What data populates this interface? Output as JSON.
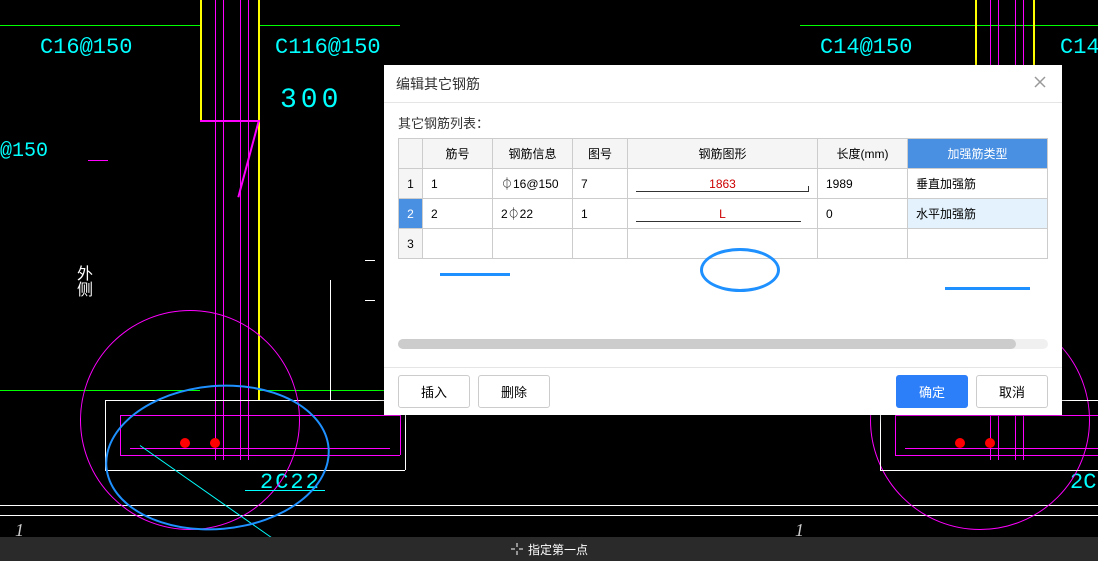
{
  "dialog": {
    "title": "编辑其它钢筋",
    "table_label": "其它钢筋列表：",
    "headers": {
      "col1": "筋号",
      "col2": "钢筋信息",
      "col3": "图号",
      "col4": "钢筋图形",
      "col5": "长度(mm)",
      "col6": "加强筋类型"
    },
    "rows": [
      {
        "num": "1",
        "id": "1",
        "info": "⏀16@150",
        "shape_num": "7",
        "shape_val": "1863",
        "length": "1989",
        "type": "垂直加强筋"
      },
      {
        "num": "2",
        "id": "2",
        "info": "2⏀22",
        "shape_num": "1",
        "shape_val": "L",
        "length": "0",
        "type": "水平加强筋"
      },
      {
        "num": "3",
        "id": "",
        "info": "",
        "shape_num": "",
        "shape_val": "",
        "length": "",
        "type": ""
      }
    ],
    "buttons": {
      "insert": "插入",
      "delete": "删除",
      "confirm": "确定",
      "cancel": "取消"
    }
  },
  "cad": {
    "labels": {
      "c16": "C16@150",
      "c116": "C116@150",
      "c14": "C14@150",
      "c14_2": "C14",
      "dim300": "300",
      "at150": "@150",
      "side": "外侧",
      "rebar": "2C22",
      "rebar2": "2C"
    }
  },
  "status": {
    "prompt": "指定第一点"
  },
  "page": {
    "num1": "1",
    "num2": "1"
  }
}
